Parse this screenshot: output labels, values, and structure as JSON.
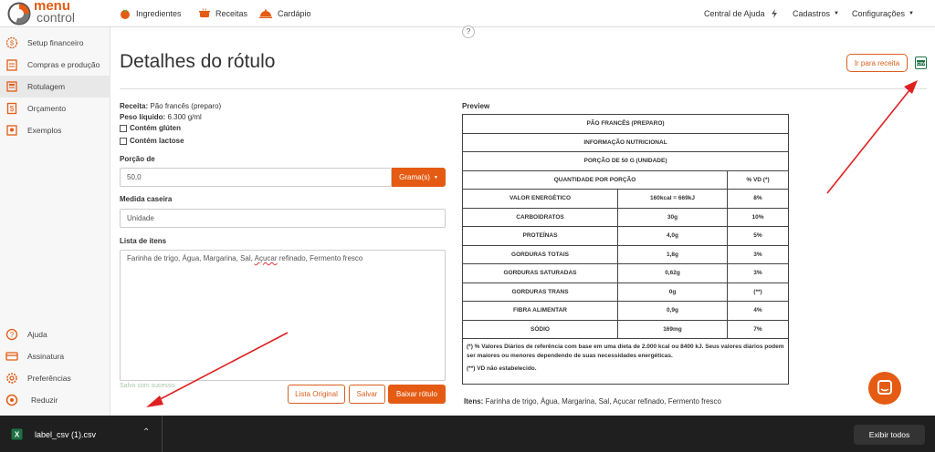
{
  "topnav": {
    "logo_line1": "menu",
    "logo_line2": "control",
    "ingredientes": "Ingredientes",
    "receitas": "Receitas",
    "cardapio": "Cardápio",
    "help": "Central de Ajuda",
    "cadastros": "Cadastros",
    "configuracoes": "Configurações",
    "question": "?"
  },
  "sidebar": {
    "items": [
      {
        "label": "Setup financeiro"
      },
      {
        "label": "Compras e produção"
      },
      {
        "label": "Rotulagem"
      },
      {
        "label": "Orçamento"
      },
      {
        "label": "Exemplos"
      }
    ],
    "bottom": [
      {
        "label": "Ajuda"
      },
      {
        "label": "Assinatura"
      },
      {
        "label": "Preferências"
      },
      {
        "label": "Reduzir"
      }
    ]
  },
  "page": {
    "title": "Detalhes do rótulo",
    "go_recipe_btn": "Ir para receita",
    "receita_label": "Receita:",
    "receita_value": "Pão francês (preparo)",
    "peso_label": "Peso líquido:",
    "peso_value": "6.300 g/ml",
    "gluten": "Contém glúten",
    "lactose": "Contém lactose",
    "porcao_label": "Porção de",
    "porcao_value": "50,0",
    "unit_btn": "Grama(s)",
    "medida_label": "Medida caseira",
    "medida_value": "Unidade",
    "lista_label": "Lista de itens",
    "lista_value_pre": "Farinha de trigo, Água, Margarina, Sal, ",
    "lista_value_sp": "Açucar",
    "lista_value_post": " refinado, Fermento fresco",
    "saved": "Salvo com sucesso",
    "btn_original": "Lista Original",
    "btn_salvar": "Salvar",
    "btn_baixar": "Baixar rótulo"
  },
  "preview": {
    "title": "Preview",
    "header1": "PÃO FRANCÊS (PREPARO)",
    "header2": "INFORMAÇÃO NUTRICIONAL",
    "header3": "PORÇÃO DE 50 G (UNIDADE)",
    "col_qty": "QUANTIDADE POR PORÇÃO",
    "col_vd": "% VD (*)",
    "rows": [
      {
        "name": "VALOR ENERGÉTICO",
        "qty": "160kcal = 669kJ",
        "vd": "8%"
      },
      {
        "name": "CARBOIDRATOS",
        "qty": "30g",
        "vd": "10%"
      },
      {
        "name": "PROTEÍNAS",
        "qty": "4,0g",
        "vd": "5%"
      },
      {
        "name": "GORDURAS TOTAIS",
        "qty": "1,8g",
        "vd": "3%"
      },
      {
        "name": "GORDURAS SATURADAS",
        "qty": "0,62g",
        "vd": "3%"
      },
      {
        "name": "GORDURAS TRANS",
        "qty": "0g",
        "vd": "(**)"
      },
      {
        "name": "FIBRA ALIMENTAR",
        "qty": "0,9g",
        "vd": "4%"
      },
      {
        "name": "SÓDIO",
        "qty": "169mg",
        "vd": "7%"
      }
    ],
    "footnote1": "(*) % Valores Diários de referência com base em uma dieta de 2.000 kcal ou 8400 kJ. Seus valores diários podem ser maiores ou menores dependendo de suas necessidades energéticas.",
    "footnote2": "(**) VD não estabelecido.",
    "items_label": "Itens:",
    "items_value": "Farinha de trigo, Água, Margarina, Sal, Açucar refinado, Fermento fresco"
  },
  "download": {
    "filename": "label_csv (1).csv",
    "show_all": "Exibir todos"
  },
  "colors": {
    "accent": "#e55b13",
    "annotation": "#e02020"
  }
}
